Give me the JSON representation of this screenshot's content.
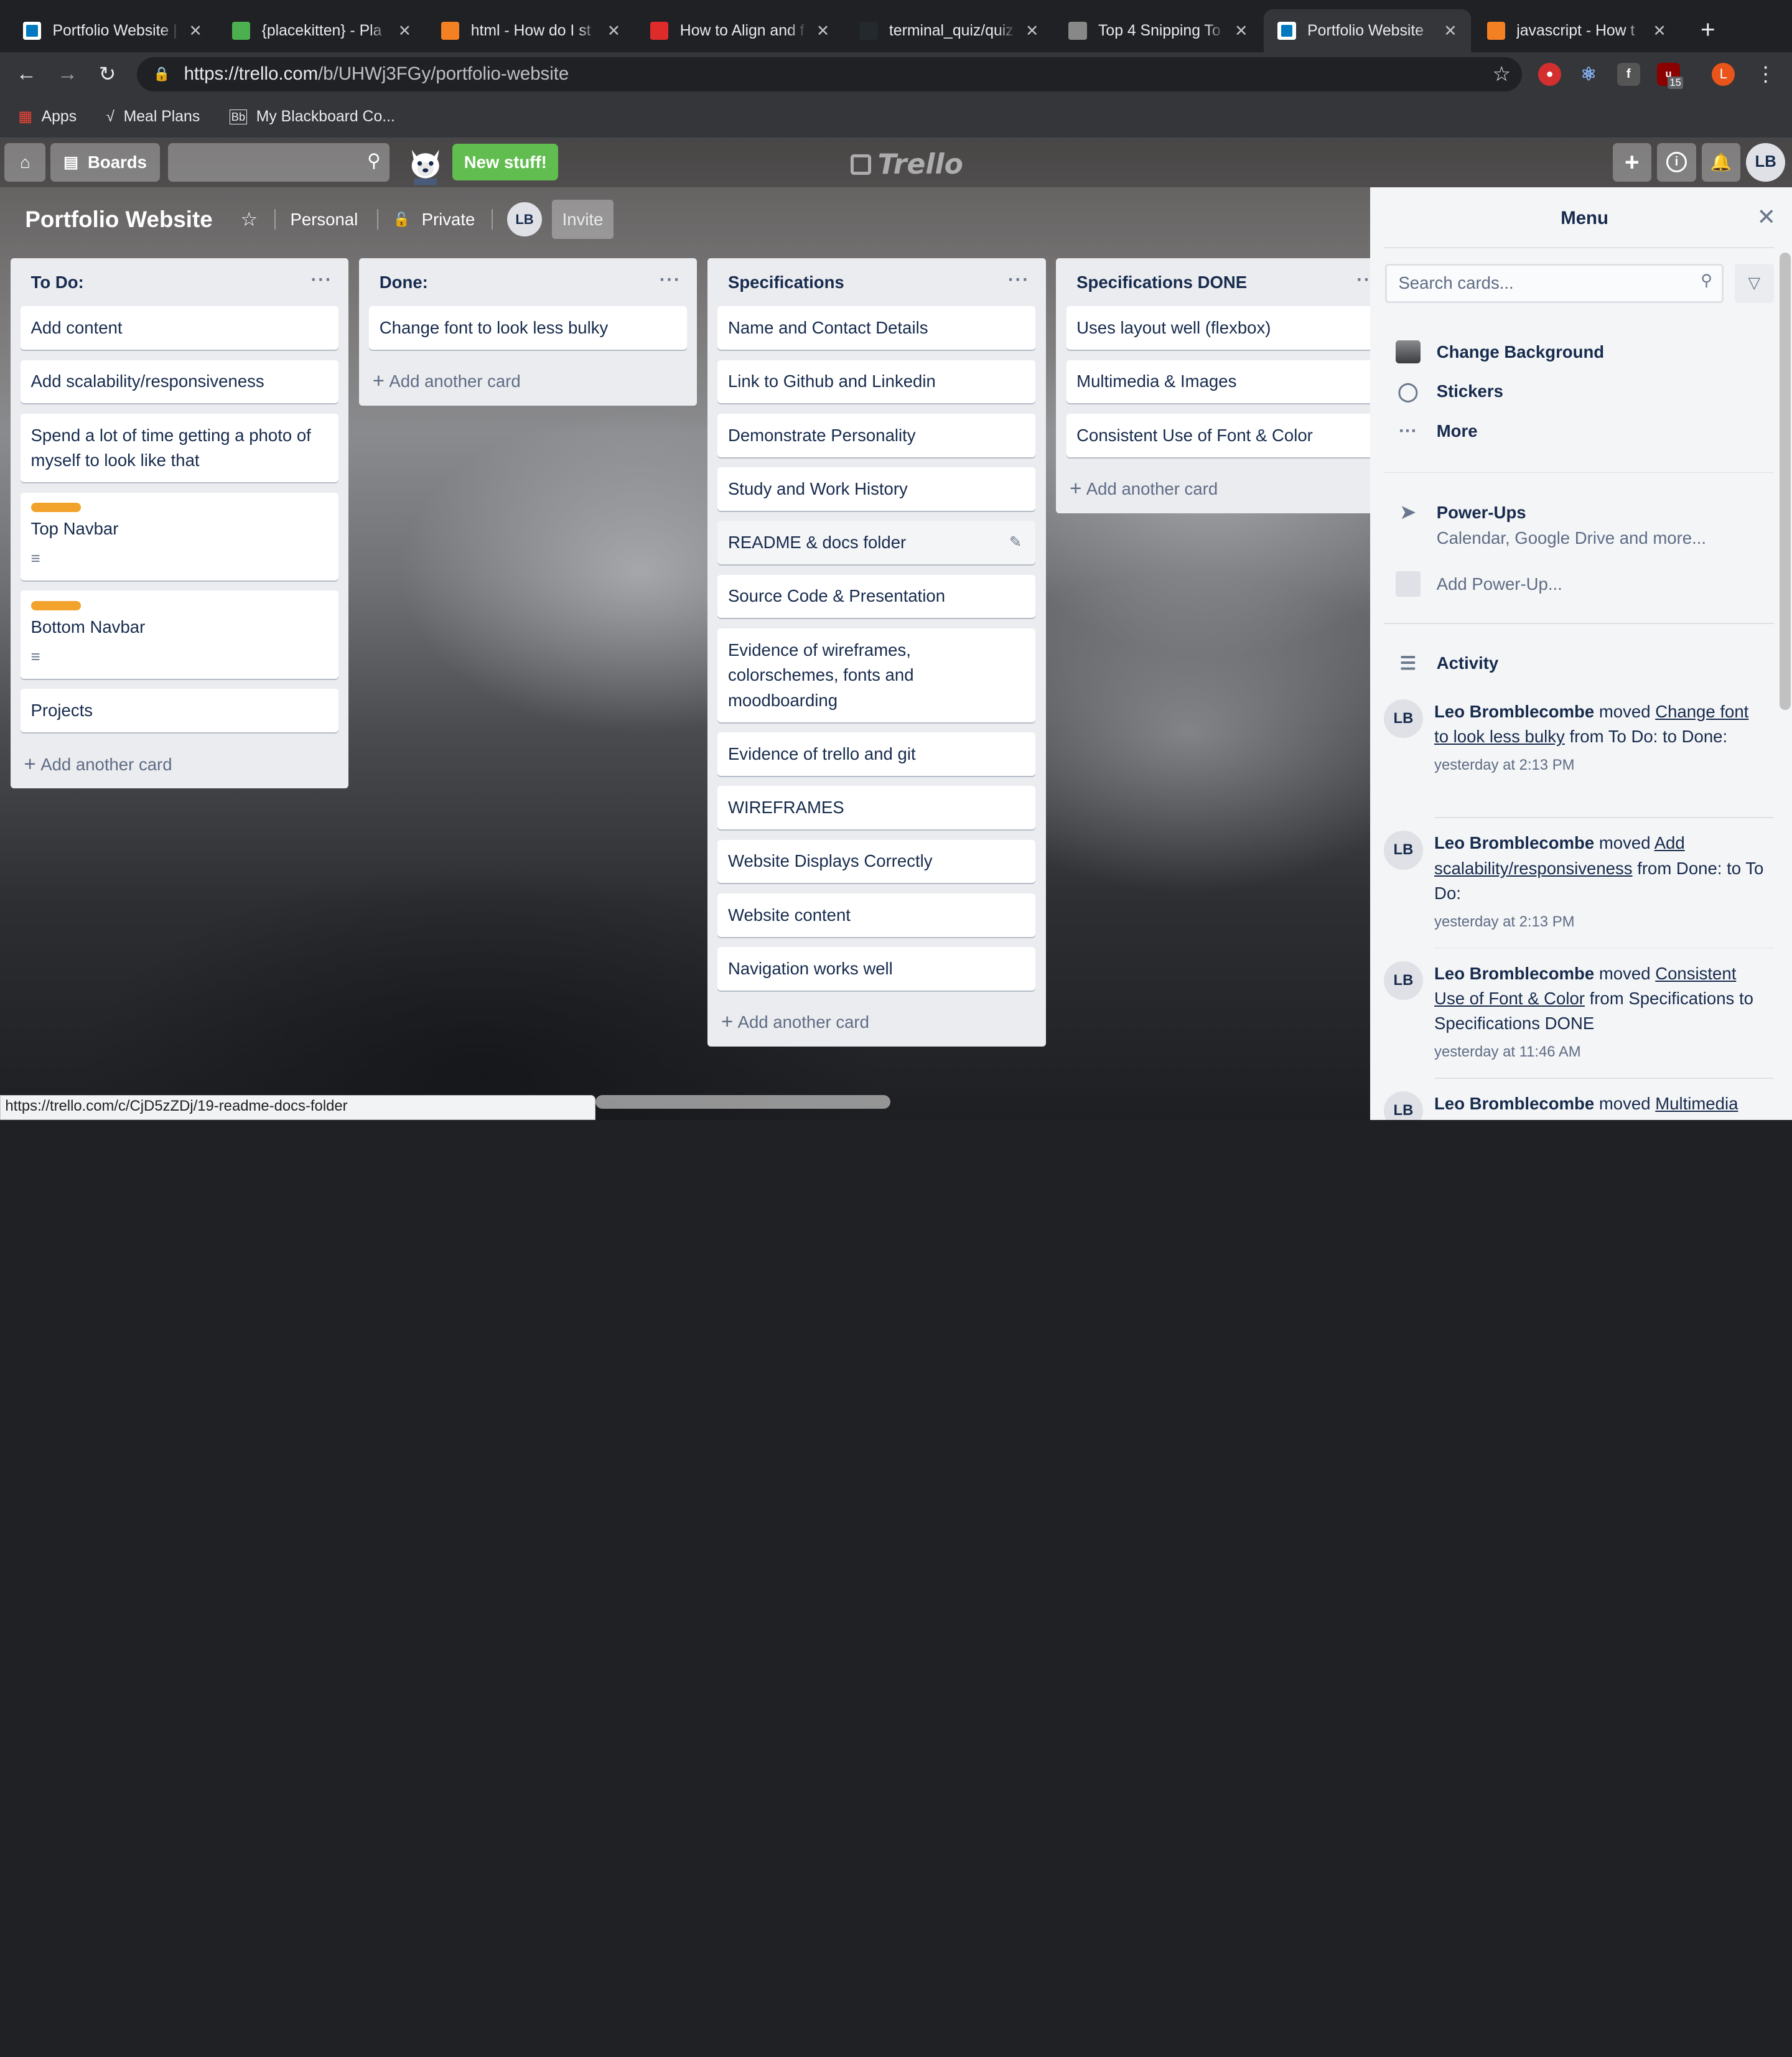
{
  "browser": {
    "tabs": [
      {
        "title": "Portfolio Website |",
        "icon": "trello-icon",
        "color": "#ffffff"
      },
      {
        "title": "{placekitten} - Pla",
        "icon": "placekitten-icon",
        "color": "#4caf50"
      },
      {
        "title": "html - How do I st",
        "icon": "stackoverflow-icon",
        "color": "#f48024"
      },
      {
        "title": "How to Align and f",
        "icon": "red-flag-icon",
        "color": "#e02b2b"
      },
      {
        "title": "terminal_quiz/quiz",
        "icon": "github-icon",
        "color": "#24292e"
      },
      {
        "title": "Top 4 Snipping To",
        "icon": "person-icon",
        "color": "#888888"
      },
      {
        "title": "Portfolio Website",
        "icon": "trello-icon",
        "color": "#ffffff"
      },
      {
        "title": "javascript - How t",
        "icon": "stackoverflow-icon",
        "color": "#f48024"
      }
    ],
    "active_tab_index": 6,
    "url_prefix": "https://",
    "url_host": "trello.com",
    "url_path": "/b/UHWj3FGy/portfolio-website",
    "profile_initial": "L",
    "ext_badge": "15",
    "bookmarks": [
      {
        "label": "Apps",
        "icon": "apps-grid-icon"
      },
      {
        "label": "Meal Plans",
        "icon": "meal-plans-icon"
      },
      {
        "label": "My Blackboard Co...",
        "icon": "blackboard-icon"
      }
    ],
    "status_url": "https://trello.com/c/CjD5zZDj/19-readme-docs-folder"
  },
  "trello": {
    "boards_label": "Boards",
    "new_stuff_label": "New stuff!",
    "logo_text": "Trello",
    "user_initials": "LB",
    "board_title": "Portfolio Website",
    "team_label": "Personal",
    "visibility_label": "Private",
    "invite_label": "Invite"
  },
  "lists": [
    {
      "title": "To Do:",
      "cards": [
        {
          "text": "Add content"
        },
        {
          "text": "Add scalability/responsiveness"
        },
        {
          "text": "Spend a lot of time getting a photo of myself to look like that"
        },
        {
          "text": "Top Navbar",
          "label_color": "#f2a32b",
          "has_description": true
        },
        {
          "text": "Bottom Navbar",
          "label_color": "#f2a32b",
          "has_description": true
        },
        {
          "text": "Projects"
        }
      ],
      "add_label": "Add another card"
    },
    {
      "title": "Done:",
      "cards": [
        {
          "text": "Change font to look less bulky"
        }
      ],
      "add_label": "Add another card"
    },
    {
      "title": "Specifications",
      "cards": [
        {
          "text": "Name and Contact Details"
        },
        {
          "text": "Link to Github and Linkedin"
        },
        {
          "text": "Demonstrate Personality"
        },
        {
          "text": "Study and Work History"
        },
        {
          "text": "README & docs folder",
          "hover": true
        },
        {
          "text": "Source Code & Presentation"
        },
        {
          "text": "Evidence of wireframes, colorschemes, fonts and moodboarding"
        },
        {
          "text": "Evidence of trello and git"
        },
        {
          "text": "WIREFRAMES"
        },
        {
          "text": "Website Displays Correctly"
        },
        {
          "text": "Website content"
        },
        {
          "text": "Navigation works well"
        }
      ],
      "add_label": "Add another card"
    },
    {
      "title": "Specifications DONE",
      "cards": [
        {
          "text": "Uses layout well (flexbox)"
        },
        {
          "text": "Multimedia & Images"
        },
        {
          "text": "Consistent Use of Font & Color"
        }
      ],
      "add_label": "Add another card"
    }
  ],
  "menu": {
    "title": "Menu",
    "search_placeholder": "Search cards...",
    "change_background": "Change Background",
    "stickers": "Stickers",
    "more": "More",
    "powerups": "Power-Ups",
    "powerups_sub": "Calendar, Google Drive and more...",
    "add_powerup": "Add Power-Up...",
    "activity": "Activity",
    "activities": [
      {
        "user": "Leo Bromblecombe",
        "verb": "moved",
        "card": "Change font to look less bulky",
        "rest": "from To Do: to Done:",
        "time": "yesterday at 2:13 PM"
      },
      {
        "user": "Leo Bromblecombe",
        "verb": "moved",
        "card": "Add scalability/responsiveness",
        "rest": "from Done: to To Do:",
        "time": "yesterday at 2:13 PM"
      },
      {
        "user": "Leo Bromblecombe",
        "verb": "moved",
        "card": "Consistent Use of Font & Color",
        "rest": "from Specifications to Specifications DONE",
        "time": "yesterday at 11:46 AM"
      },
      {
        "user": "Leo Bromblecombe",
        "verb": "moved",
        "card": "Multimedia",
        "rest": "",
        "time": ""
      }
    ]
  }
}
